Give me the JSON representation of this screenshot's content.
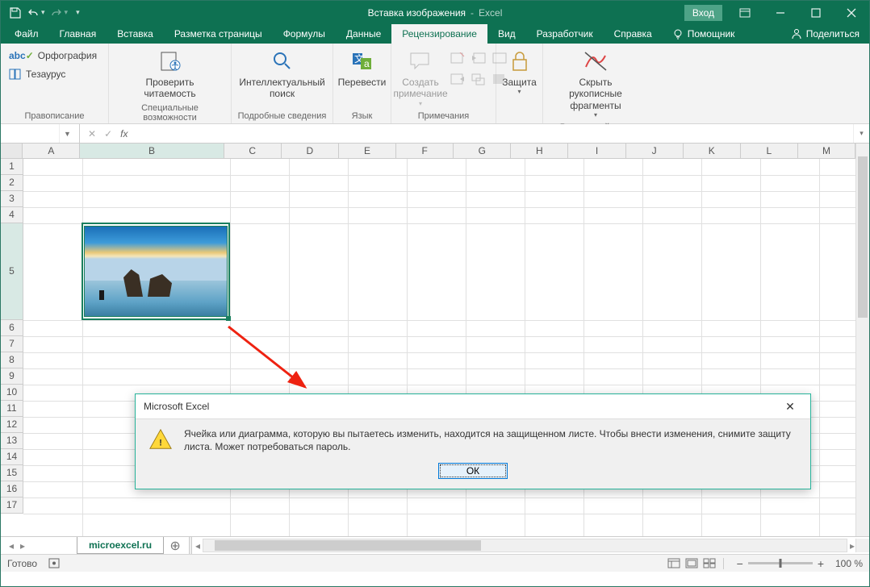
{
  "titlebar": {
    "doc": "Вставка изображения",
    "app": "Excel",
    "login": "Вход"
  },
  "tabs": {
    "file": "Файл",
    "home": "Главная",
    "insert": "Вставка",
    "layout": "Разметка страницы",
    "formulas": "Формулы",
    "data": "Данные",
    "review": "Рецензирование",
    "view": "Вид",
    "developer": "Разработчик",
    "help": "Справка",
    "tellme": "Помощник",
    "share": "Поделиться"
  },
  "ribbon": {
    "proofing": {
      "spelling": "Орфография",
      "thesaurus": "Тезаурус",
      "group": "Правописание"
    },
    "access": {
      "check": "Проверить\nчитаемость",
      "group": "Специальные возможности"
    },
    "insights": {
      "lookup": "Интеллектуальный\nпоиск",
      "group": "Подробные сведения"
    },
    "lang": {
      "translate": "Перевести",
      "group": "Язык"
    },
    "comments": {
      "new": "Создать\nпримечание",
      "group": "Примечания"
    },
    "protect": {
      "protect": "Защита",
      "group": ""
    },
    "ink": {
      "hide": "Скрыть рукописные\nфрагменты",
      "group": "Рукописный ввод"
    }
  },
  "namebox": "",
  "sheet": {
    "cols": [
      "A",
      "B",
      "C",
      "D",
      "E",
      "F",
      "G",
      "H",
      "I",
      "J",
      "K",
      "L",
      "M"
    ],
    "rows": [
      "1",
      "2",
      "3",
      "4",
      "5",
      "6",
      "7",
      "8",
      "9",
      "10",
      "11",
      "12",
      "13",
      "14",
      "15",
      "16",
      "17"
    ],
    "tab": "microexcel.ru"
  },
  "dialog": {
    "title": "Microsoft Excel",
    "text": "Ячейка или диаграмма, которую вы пытаетесь изменить, находится на защищенном листе. Чтобы внести изменения, снимите защиту листа. Может потребоваться пароль.",
    "ok": "ОК"
  },
  "status": {
    "ready": "Готово",
    "zoom": "100 %"
  }
}
